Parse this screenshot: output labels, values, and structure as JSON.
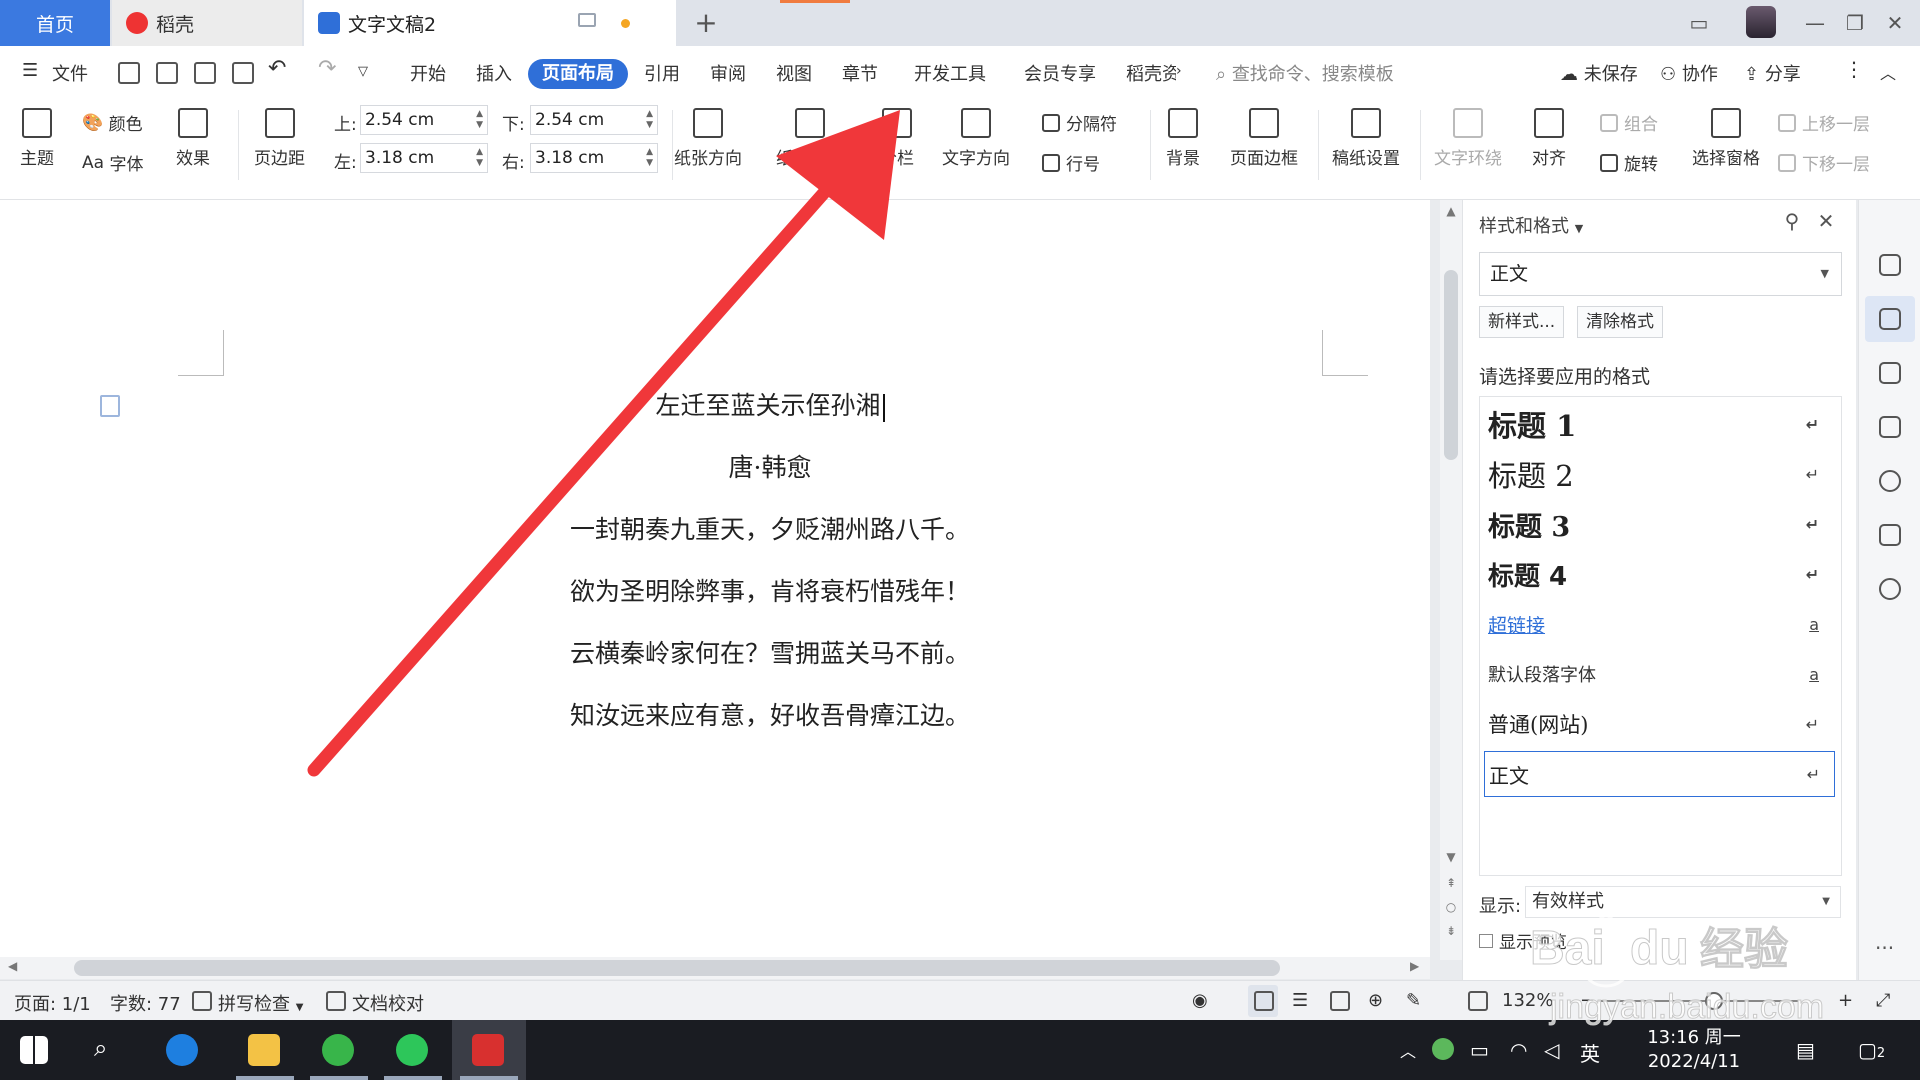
{
  "tabs": {
    "home": "首页",
    "daoke": "稻壳",
    "doc": "文字文稿2",
    "add": "+"
  },
  "menu": {
    "file": "文件",
    "items": [
      "开始",
      "插入",
      "页面布局",
      "引用",
      "审阅",
      "视图",
      "章节",
      "开发工具",
      "会员专享",
      "稻壳资"
    ],
    "active": "页面布局",
    "search_placeholder": "查找命令、搜索模板",
    "unsaved": "未保存",
    "collab": "协作",
    "share": "分享"
  },
  "ribbon": {
    "theme": "主题",
    "color": "颜色",
    "font": "字体",
    "effect": "效果",
    "margin": "页边距",
    "top_label": "上:",
    "top_value": "2.54 cm",
    "bottom_label": "下:",
    "bottom_value": "2.54 cm",
    "left_label": "左:",
    "left_value": "3.18 cm",
    "right_label": "右:",
    "right_value": "3.18 cm",
    "orientation": "纸张方向",
    "size": "纸张大小",
    "columns": "分栏",
    "text_direction": "文字方向",
    "separator": "分隔符",
    "line_number": "行号",
    "background": "背景",
    "page_border": "页面边框",
    "manuscript": "稿纸设置",
    "text_wrap": "文字环绕",
    "align": "对齐",
    "group": "组合",
    "rotate": "旋转",
    "selection_pane": "选择窗格",
    "bring_forward": "上移一层",
    "send_backward": "下移一层"
  },
  "document": {
    "title": "左迁至蓝关示侄孙湘",
    "author": "唐·韩愈",
    "lines": [
      "一封朝奏九重天，夕贬潮州路八千。",
      "欲为圣明除弊事，肯将衰朽惜残年！",
      "云横秦岭家何在？雪拥蓝关马不前。",
      "知汝远来应有意，好收吾骨瘴江边。"
    ]
  },
  "panel": {
    "title": "样式和格式",
    "current_style": "正文",
    "new_style": "新样式...",
    "clear_format": "清除格式",
    "apply_label": "请选择要应用的格式",
    "styles": [
      {
        "label": "标题 1",
        "icon": "return-icon"
      },
      {
        "label": "标题 2",
        "icon": "return-icon"
      },
      {
        "label": "标题 3",
        "icon": "return-icon"
      },
      {
        "label": "标题 4",
        "icon": "return-icon"
      },
      {
        "label": "超链接",
        "icon": "char-style-icon"
      },
      {
        "label": "默认段落字体",
        "icon": "char-style-icon"
      },
      {
        "label": "普通(网站)",
        "icon": "return-icon"
      },
      {
        "label": "正文",
        "icon": "return-icon"
      }
    ],
    "selected_style": "正文",
    "show_label": "显示:",
    "show_value": "有效样式",
    "preview_label": "显示预览"
  },
  "status": {
    "page": "页面: 1/1",
    "words": "字数: 77",
    "spell": "拼写检查",
    "proof": "文档校对",
    "zoom": "132%",
    "zoom_fraction": 0.58
  },
  "taskbar": {
    "time": "13:16 周一",
    "date": "2022/4/11",
    "ime": "英",
    "notifications": "2"
  },
  "watermark": {
    "brand": "Baidu经验",
    "url": "jingyan.baidu.com"
  },
  "colors": {
    "accent": "#2f6fd8",
    "arrow": "#f0373a",
    "home_tab": "#3b79e0",
    "taskbar": "#1a1c22"
  }
}
